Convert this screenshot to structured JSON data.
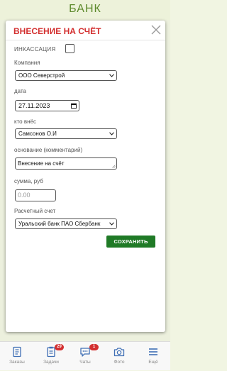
{
  "header": {
    "title": "БАНК"
  },
  "modal": {
    "title": "ВНЕСЕНИЕ НА СЧЁТ",
    "fields": {
      "incasso": {
        "label": "ИНКАССАЦИЯ",
        "checked": false
      },
      "company": {
        "label": "Компания",
        "value": "ООО Северстрой"
      },
      "date": {
        "label": "дата",
        "value": "27.11.2023"
      },
      "depositor": {
        "label": "кто внёс",
        "value": "Самсонов О.И"
      },
      "basis": {
        "label": "основание (комментарий)",
        "value": "Внесение на счёт"
      },
      "amount": {
        "label": "сумма, руб",
        "placeholder": "0.00"
      },
      "account": {
        "label": "Расчетный счет",
        "value": "Уральский банк ПАО Сбербанк"
      }
    },
    "save_label": "СОХРАНИТЬ"
  },
  "bottom_nav": [
    {
      "label": "Заказы",
      "icon": "orders-icon"
    },
    {
      "label": "Задачи",
      "icon": "tasks-icon",
      "badge": "29"
    },
    {
      "label": "Чаты",
      "icon": "chat-icon",
      "badge": "1"
    },
    {
      "label": "Фото",
      "icon": "camera-icon"
    },
    {
      "label": "Ещё",
      "icon": "menu-icon"
    }
  ],
  "colors": {
    "accent_green": "#1f7a26",
    "title_red": "#d32f2f",
    "header_green": "#5d8a2c",
    "nav_blue": "#3f6fb5"
  }
}
